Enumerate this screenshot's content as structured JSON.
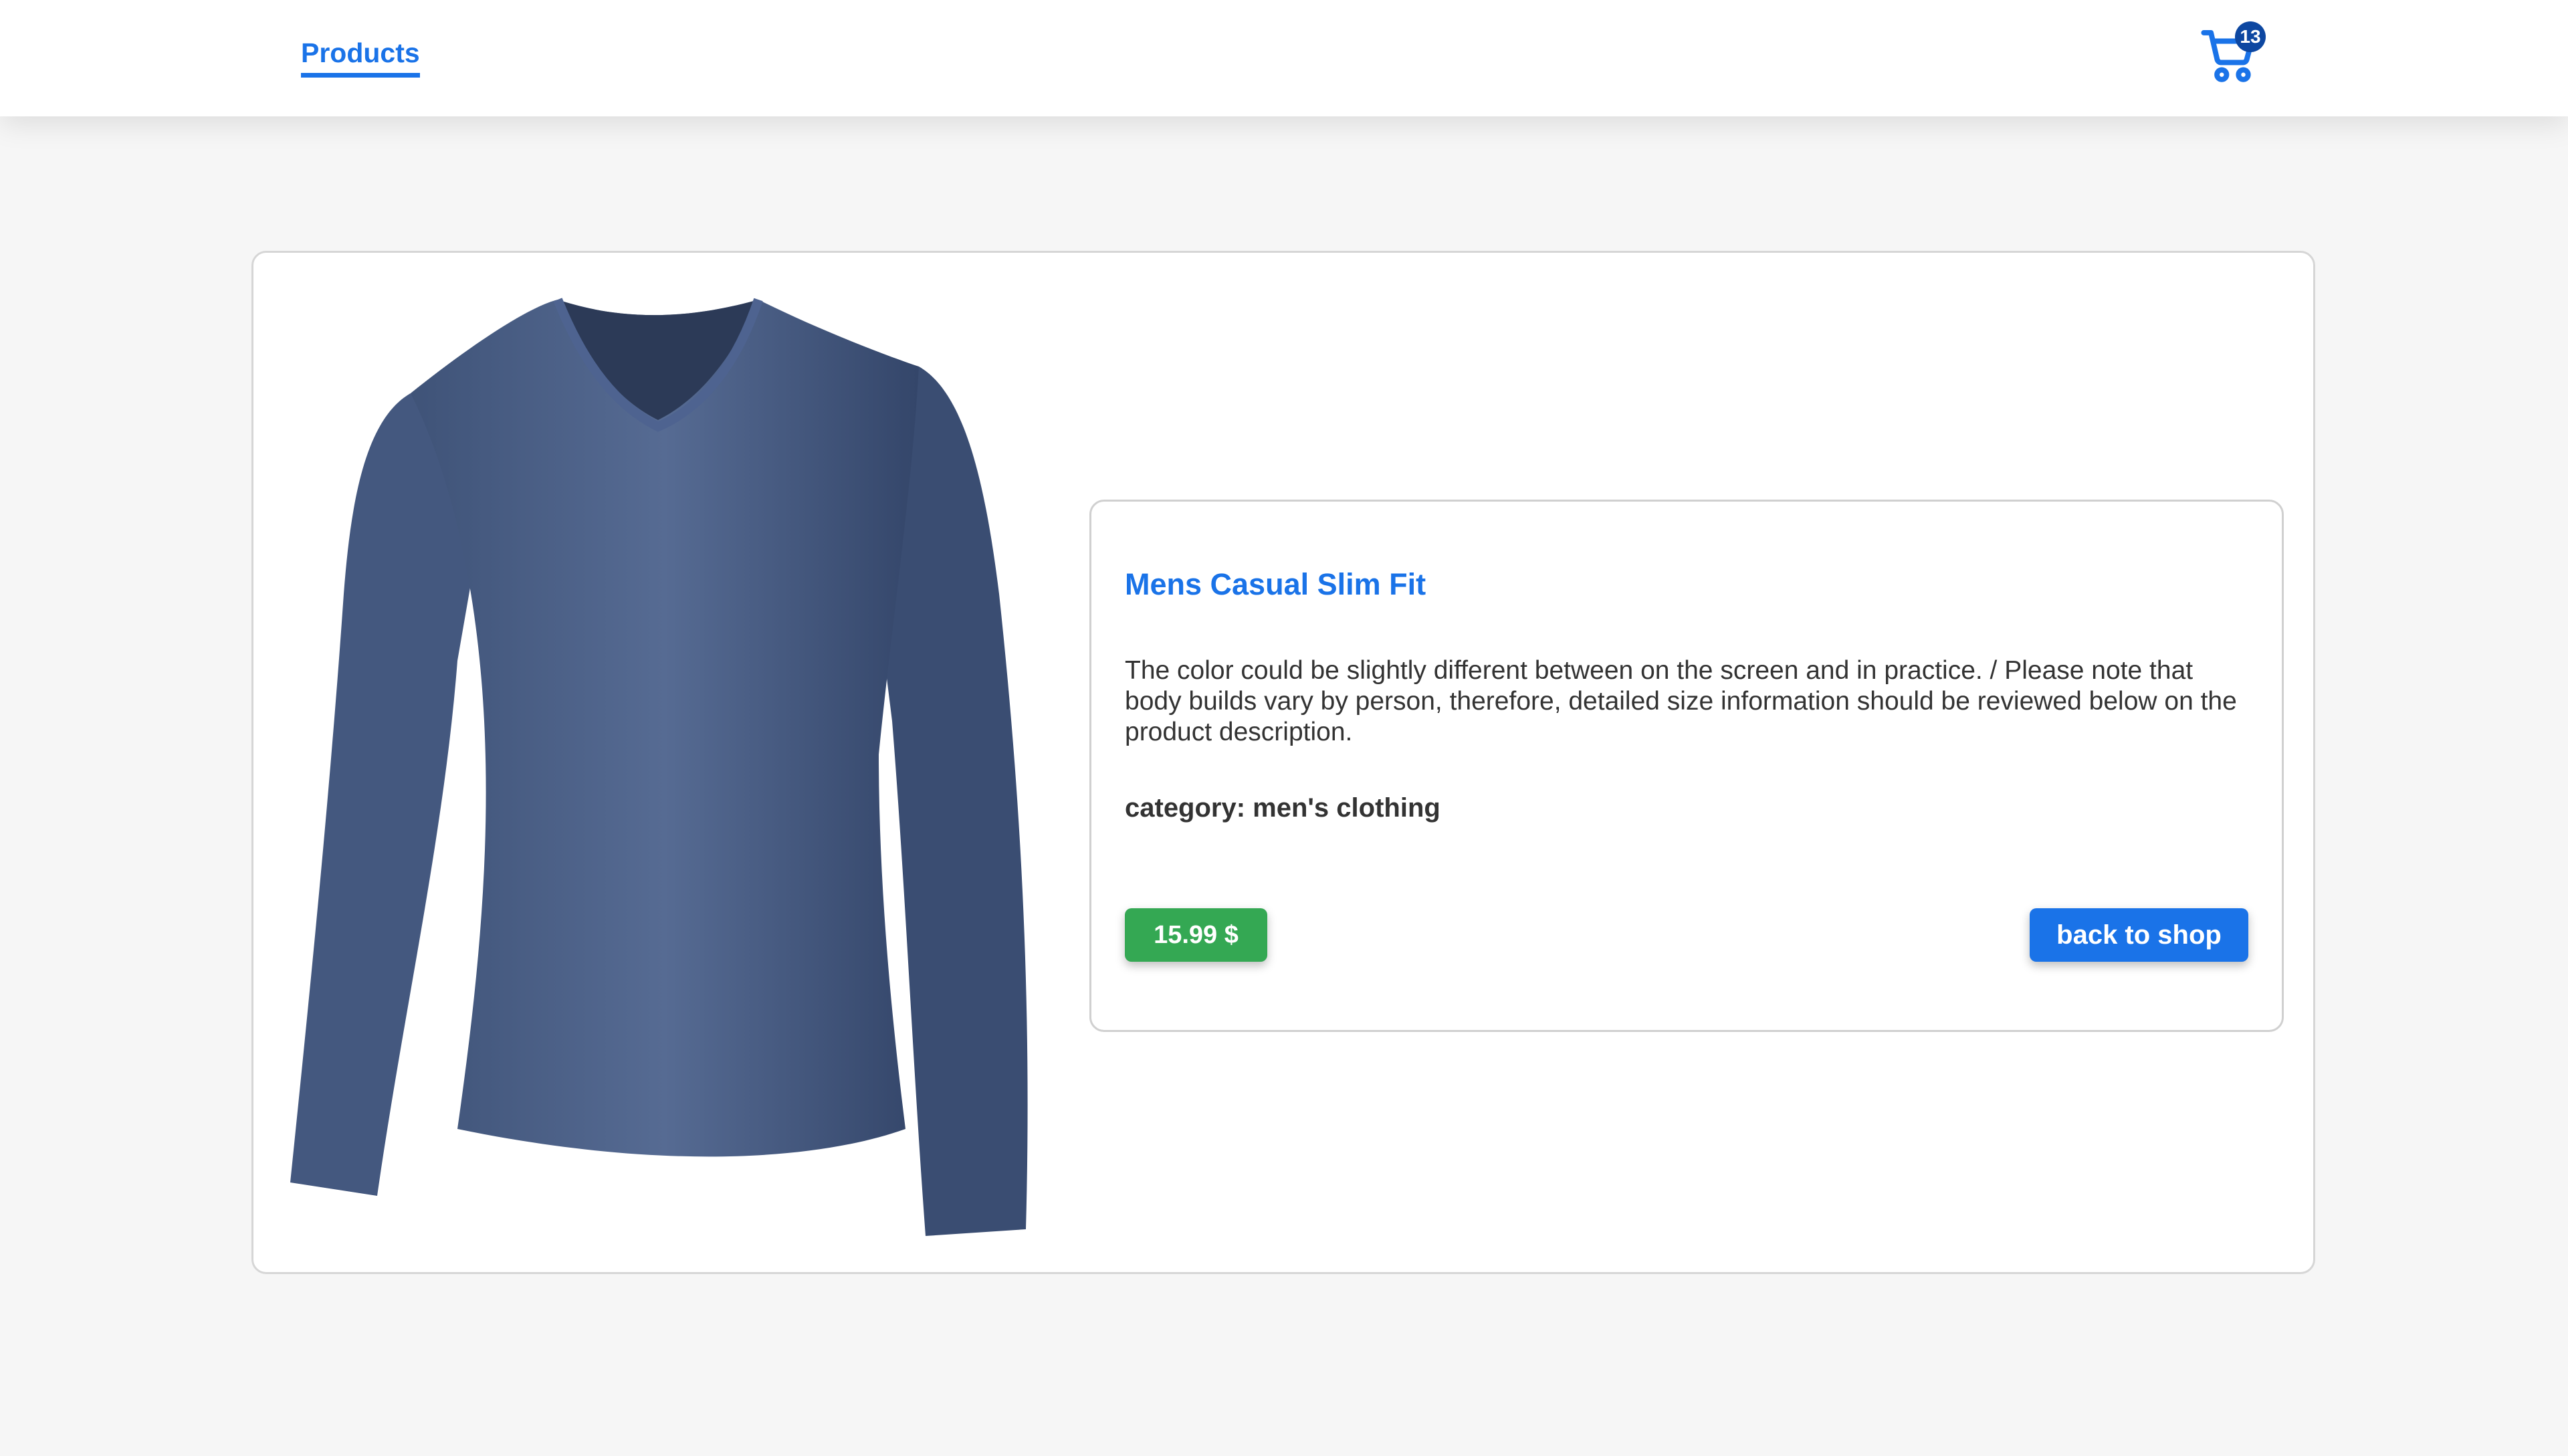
{
  "nav": {
    "products_label": "Products",
    "cart_count": "13",
    "cart_icon": "shopping-cart-icon"
  },
  "product": {
    "title": "Mens Casual Slim Fit",
    "description": "The color could be slightly different between on the screen and in practice. / Please note that body builds vary by person, therefore, detailed size information should be reviewed below on the product description.",
    "category_text": "category: men's clothing",
    "price_text": "15.99 $",
    "image_alt": "Mens Casual Slim Fit"
  },
  "actions": {
    "back_label": "back to shop"
  },
  "colors": {
    "accent": "#1a73e8",
    "price_bg": "#34a853",
    "badge_bg": "#0d47a1",
    "page_bg": "#f6f6f6",
    "shirt": "#4a5f85"
  }
}
